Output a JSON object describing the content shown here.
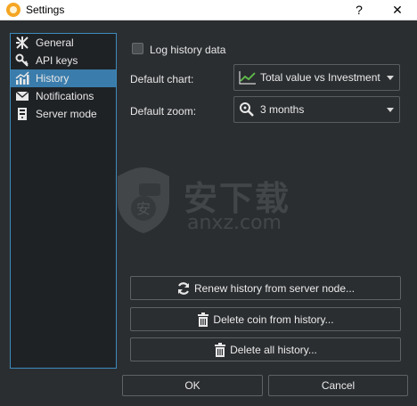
{
  "window": {
    "title": "Settings",
    "help_label": "?",
    "close_label": "✕"
  },
  "sidebar": {
    "items": [
      {
        "label": "General",
        "icon": "tools-icon",
        "active": false
      },
      {
        "label": "API keys",
        "icon": "key-icon",
        "active": false
      },
      {
        "label": "History",
        "icon": "chart-icon",
        "active": true
      },
      {
        "label": "Notifications",
        "icon": "envelope-icon",
        "active": false
      },
      {
        "label": "Server mode",
        "icon": "server-icon",
        "active": false
      }
    ]
  },
  "history": {
    "log_label": "Log history data",
    "log_checked": false,
    "default_chart_label": "Default chart:",
    "default_chart_value": "Total value vs Investment",
    "default_zoom_label": "Default zoom:",
    "default_zoom_value": "3 months",
    "renew_label": "Renew history from server node...",
    "delete_coin_label": "Delete coin from history...",
    "delete_all_label": "Delete all history..."
  },
  "dialog": {
    "ok_label": "OK",
    "cancel_label": "Cancel"
  },
  "watermark": {
    "main": "安下载",
    "sub": "anxz.com",
    "badge": "安"
  },
  "colors": {
    "accent": "#3a7cab",
    "sidebar_border": "#3d8bbd",
    "background": "#2b2e31",
    "chart_icon_green": "#5fbf4a"
  }
}
